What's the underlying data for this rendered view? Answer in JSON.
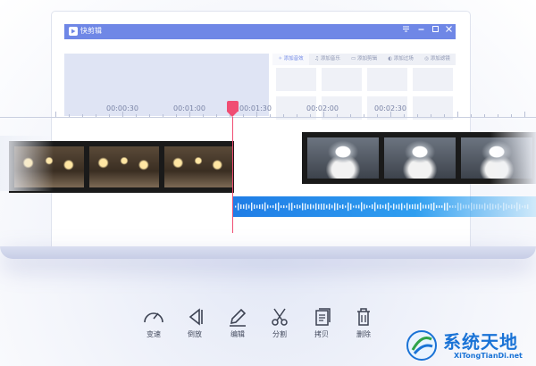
{
  "app": {
    "title": "快剪辑",
    "window_controls": [
      "menu-icon",
      "minimize-icon",
      "maximize-icon",
      "close-icon"
    ]
  },
  "library_tabs": [
    {
      "label": "添加音效",
      "icon": "effect-icon",
      "active": true
    },
    {
      "label": "添加音乐",
      "icon": "music-icon",
      "active": false
    },
    {
      "label": "添加剪辑",
      "icon": "clip-icon",
      "active": false
    },
    {
      "label": "添加过场",
      "icon": "transition-icon",
      "active": false
    },
    {
      "label": "添加滤镜",
      "icon": "filter-icon",
      "active": false
    }
  ],
  "timeline": {
    "time_labels": [
      "00:00:30",
      "00:01:00",
      "00:01:30",
      "00:02:00",
      "00:02:30"
    ],
    "playhead_time": "00:01:30",
    "colors": {
      "accent": "#6f87e6",
      "playhead": "#f04d73",
      "audio": "#1f7de6"
    }
  },
  "toolbar": [
    {
      "label": "变速",
      "icon": "speed-gauge-icon"
    },
    {
      "label": "倒放",
      "icon": "reverse-play-icon"
    },
    {
      "label": "编辑",
      "icon": "pencil-icon"
    },
    {
      "label": "分割",
      "icon": "scissors-icon"
    },
    {
      "label": "拷贝",
      "icon": "copy-icon"
    },
    {
      "label": "删除",
      "icon": "trash-icon"
    }
  ],
  "watermark": {
    "title": "系统天地",
    "url": "XiTongTianDi.net"
  }
}
